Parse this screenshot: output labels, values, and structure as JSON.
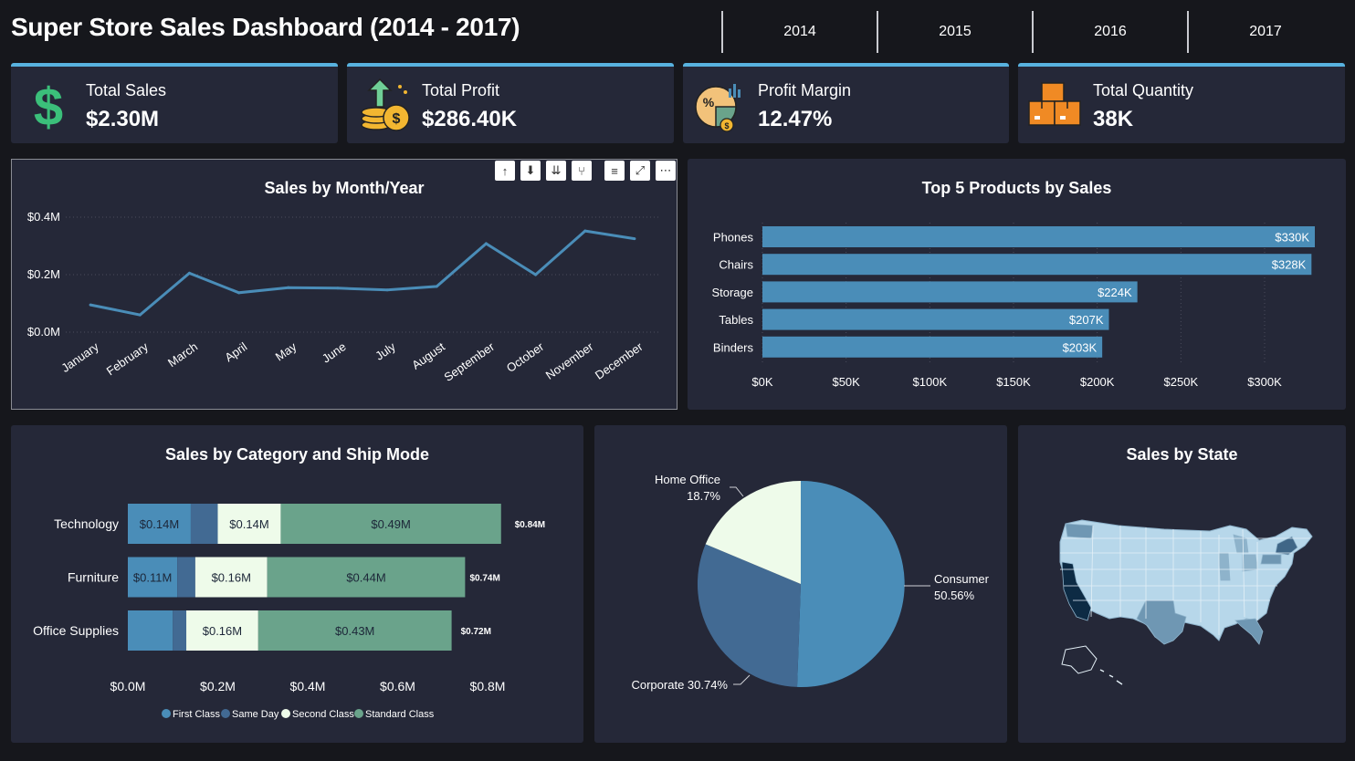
{
  "header": {
    "title": "Super Store Sales Dashboard (2014 - 2017)"
  },
  "years": [
    "2014",
    "2015",
    "2016",
    "2017"
  ],
  "kpis": [
    {
      "label": "Total Sales",
      "value": "$2.30M",
      "icon": "dollar-icon"
    },
    {
      "label": "Total Profit",
      "value": "$286.40K",
      "icon": "coins-icon"
    },
    {
      "label": "Profit Margin",
      "value": "12.47%",
      "icon": "percent-chart-icon"
    },
    {
      "label": "Total Quantity",
      "value": "38K",
      "icon": "boxes-icon"
    }
  ],
  "colors": {
    "accent": "#58b2df",
    "panel": "#252838",
    "first_class": "#4a8db8",
    "same_day": "#426a93",
    "second_class": "#eefbea",
    "standard_class": "#6aa38b",
    "line": "#4a8db8"
  },
  "toolbar_icons": [
    "arrow-up-icon",
    "drill-down-icon",
    "expand-level-icon",
    "expand-hierarchy-icon",
    "filter-icon",
    "focus-mode-icon",
    "more-options-icon"
  ],
  "chart_data": [
    {
      "type": "line",
      "title": "Sales by Month/Year",
      "x": [
        "January",
        "February",
        "March",
        "April",
        "May",
        "June",
        "July",
        "August",
        "September",
        "October",
        "November",
        "December"
      ],
      "series": [
        {
          "values": [
            0.095,
            0.06,
            0.205,
            0.137,
            0.155,
            0.153,
            0.147,
            0.159,
            0.308,
            0.2,
            0.352,
            0.325
          ]
        }
      ],
      "yticks": [
        "$0.0M",
        "$0.2M",
        "$0.4M"
      ],
      "ylim": [
        0,
        0.4
      ],
      "grid": true
    },
    {
      "type": "bar",
      "orientation": "horizontal",
      "title": "Top 5 Products by Sales",
      "categories": [
        "Phones",
        "Chairs",
        "Storage",
        "Tables",
        "Binders"
      ],
      "values": [
        330,
        328,
        224,
        207,
        203
      ],
      "labels": [
        "$330K",
        "$328K",
        "$224K",
        "$207K",
        "$203K"
      ],
      "xticks": [
        "$0K",
        "$50K",
        "$100K",
        "$150K",
        "$200K",
        "$250K",
        "$300K"
      ],
      "xlim": [
        0,
        300
      ],
      "grid": true
    },
    {
      "type": "bar",
      "orientation": "horizontal",
      "stacked": true,
      "title": "Sales by Category and Ship Mode",
      "categories": [
        "Technology",
        "Furniture",
        "Office Supplies"
      ],
      "series": [
        {
          "name": "First Class",
          "values": [
            0.14,
            0.11,
            0.1
          ],
          "labels": [
            "$0.14M",
            "$0.11M",
            ""
          ]
        },
        {
          "name": "Same Day",
          "values": [
            0.06,
            0.04,
            0.03
          ],
          "labels": [
            "",
            "",
            ""
          ]
        },
        {
          "name": "Second Class",
          "values": [
            0.14,
            0.16,
            0.16
          ],
          "labels": [
            "$0.14M",
            "$0.16M",
            "$0.16M"
          ]
        },
        {
          "name": "Standard Class",
          "values": [
            0.49,
            0.44,
            0.43
          ],
          "labels": [
            "$0.49M",
            "$0.44M",
            "$0.43M"
          ]
        }
      ],
      "totals": [
        "$0.84M",
        "$0.74M",
        "$0.72M"
      ],
      "total_values": [
        0.84,
        0.74,
        0.72
      ],
      "xticks": [
        "$0.0M",
        "$0.2M",
        "$0.4M",
        "$0.6M",
        "$0.8M"
      ],
      "xlim": [
        0,
        0.8
      ],
      "legend": "bottom"
    },
    {
      "type": "pie",
      "slices": [
        {
          "name": "Consumer",
          "value": 50.56,
          "label": "50.56%"
        },
        {
          "name": "Corporate",
          "value": 30.74,
          "label": "30.74%"
        },
        {
          "name": "Home Office",
          "value": 18.7,
          "label": "18.7%"
        }
      ]
    },
    {
      "type": "map",
      "title": "Sales by State",
      "region": "United States"
    }
  ]
}
